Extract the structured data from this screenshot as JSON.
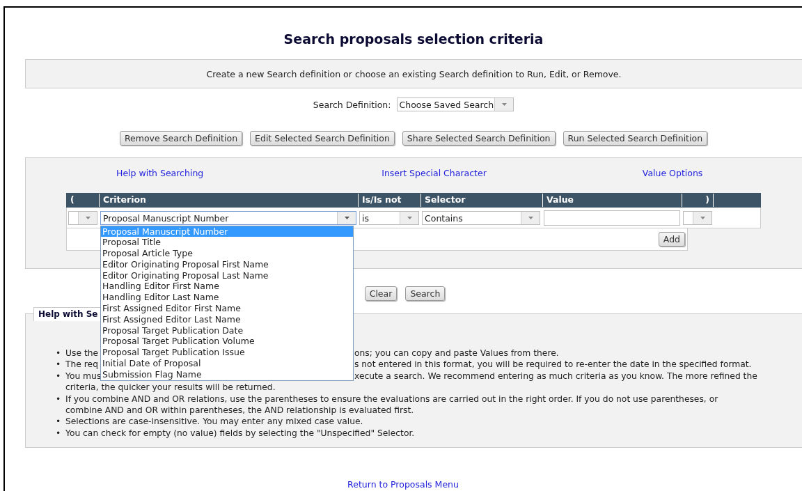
{
  "page_title": "Search proposals selection criteria",
  "intro": "Create a new Search definition or choose an existing Search definition to Run, Edit, or Remove.",
  "search_definition": {
    "label": "Search Definition:",
    "value": "Choose Saved Search"
  },
  "definition_buttons": [
    "Remove Search Definition",
    "Edit Selected Search Definition",
    "Share Selected Search Definition",
    "Run Selected Search Definition"
  ],
  "links": [
    "Help with Searching",
    "Insert Special Character",
    "Value Options"
  ],
  "criteria_table": {
    "columns": [
      "(",
      "Criterion",
      "Is/Is not",
      "Selector",
      "Value",
      ")"
    ],
    "row": {
      "criterion": "Proposal Manuscript Number",
      "operator": "is",
      "selector": "Contains"
    },
    "add_button": "Add"
  },
  "criterion_dropdown": {
    "options": [
      {
        "label": "Proposal Manuscript Number",
        "selected": true
      },
      {
        "label": "Proposal Title",
        "selected": false
      },
      {
        "label": "Proposal Article Type",
        "selected": false
      },
      {
        "label": "Editor Originating Proposal First Name",
        "selected": false
      },
      {
        "label": "Editor Originating Proposal Last Name",
        "selected": false
      },
      {
        "label": "Handling Editor First Name",
        "selected": false
      },
      {
        "label": "Handling Editor Last Name",
        "selected": false
      },
      {
        "label": "First Assigned Editor First Name",
        "selected": false
      },
      {
        "label": "First Assigned Editor Last Name",
        "selected": false
      },
      {
        "label": "Proposal Target Publication Date",
        "selected": false
      },
      {
        "label": "Proposal Target Publication Volume",
        "selected": false
      },
      {
        "label": "Proposal Target Publication Issue",
        "selected": false
      },
      {
        "label": "Initial Date of Proposal",
        "selected": false
      },
      {
        "label": "Submission Flag Name",
        "selected": false
      }
    ]
  },
  "action_buttons": [
    "Clear",
    "Search"
  ],
  "help": {
    "tab": "Help with Se",
    "bullets": [
      {
        "marker": "•",
        "lines": [
          {
            "left": "Use the",
            "right": "ons; you can copy and paste Values from there."
          }
        ]
      },
      {
        "marker": "•",
        "lines": [
          {
            "left": "The req",
            "right": "s not entered in this format, you will be required to re-enter the date in the specified format."
          }
        ]
      },
      {
        "marker": "•",
        "lines": [
          {
            "left": "You mus",
            "right": "xecute a search. We recommend entering as much criteria as you know. The more refined the"
          },
          {
            "left": "criteria, the quicker your results will be returned."
          }
        ]
      },
      {
        "marker": "•",
        "lines": [
          {
            "left": "If you combine AND and OR relations, use the parentheses to ensure the evaluations are carried out in the right order. If you do not use parentheses, or"
          },
          {
            "left": "combine AND and OR within parentheses, the AND relationship is evaluated first."
          }
        ]
      },
      {
        "marker": "•",
        "lines": [
          {
            "left": "Selections are case-insensitive. You may enter any mixed case value."
          }
        ]
      },
      {
        "marker": "•",
        "lines": [
          {
            "left": "You can check for empty (no value) fields by selecting the \"Unspecified\" Selector."
          }
        ]
      }
    ]
  },
  "return_link": "Return to Proposals Menu"
}
